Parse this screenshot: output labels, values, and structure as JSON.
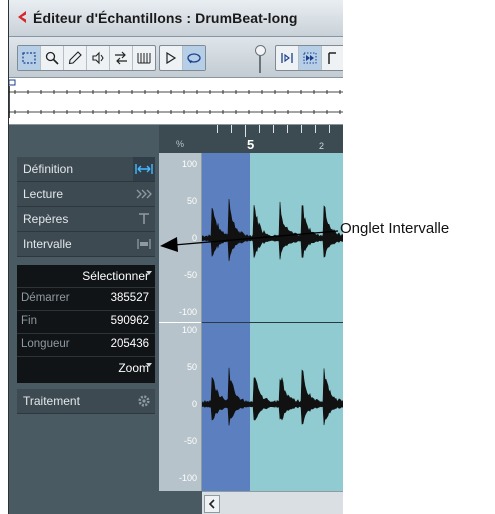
{
  "window": {
    "title": "Éditeur d'Échantillons : DrumBeat-long"
  },
  "toolbar": {
    "tools": [
      "range-select-icon",
      "zoom-icon",
      "pencil-icon",
      "play-tool-icon",
      "scrub-icon",
      "snap-grid-icon"
    ],
    "playback": [
      "play-icon",
      "loop-icon"
    ],
    "view": [
      "show-region-icon",
      "auto-scroll-icon"
    ]
  },
  "ruler": {
    "unit": "%",
    "bar_label": "5",
    "beat_label": "2"
  },
  "sidebar": {
    "tabs": [
      {
        "label": "Définition",
        "icon": "definition-icon"
      },
      {
        "label": "Lecture",
        "icon": "playback-icon"
      },
      {
        "label": "Repères",
        "icon": "markers-icon"
      },
      {
        "label": "Intervalle",
        "icon": "range-icon"
      }
    ],
    "params": {
      "select_label": "Sélectionner",
      "start_label": "Démarrer",
      "start_value": "385527",
      "end_label": "Fin",
      "end_value": "590962",
      "length_label": "Longueur",
      "length_value": "205436",
      "zoom_label": "Zoom"
    },
    "process_tab": {
      "label": "Traitement",
      "icon": "gear-icon"
    }
  },
  "yaxis": {
    "top": [
      "100",
      "50",
      "0",
      "-50",
      "-100"
    ],
    "bottom": [
      "100",
      "50",
      "0",
      "-50",
      "-100"
    ]
  },
  "annotation": {
    "label": "Onglet Intervalle"
  },
  "colors": {
    "selection": "#5b7fbf",
    "event": "#8fcbd0",
    "panel": "#4a5a63"
  }
}
